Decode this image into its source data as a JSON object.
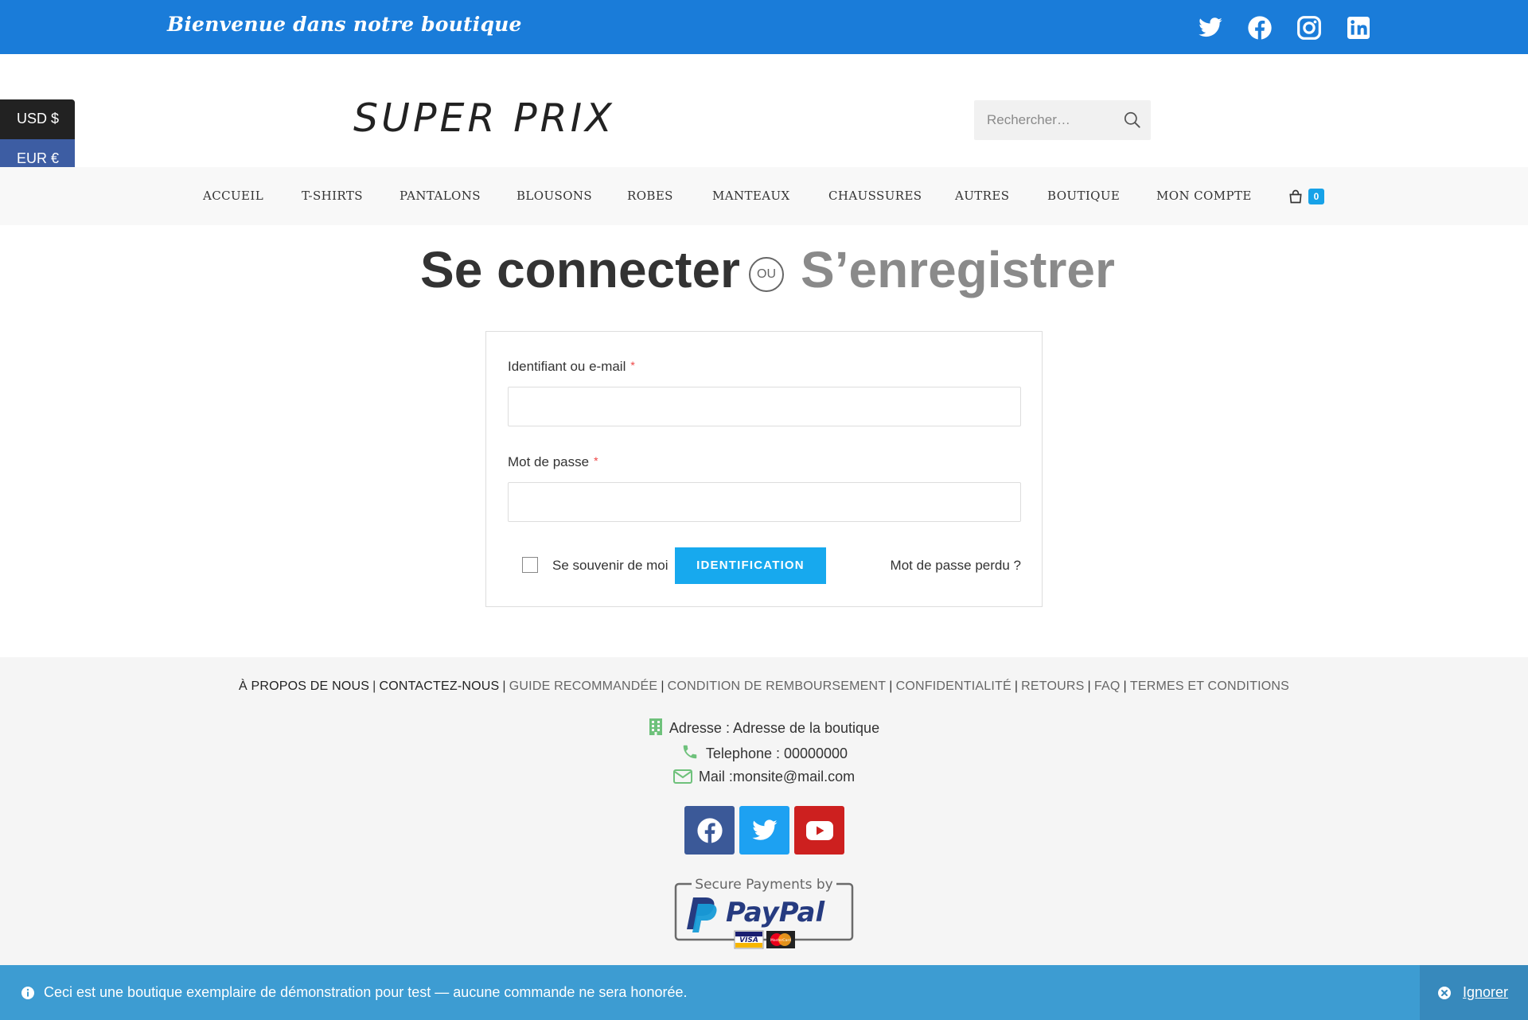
{
  "topbar": {
    "welcome": "Bienvenue dans notre boutique",
    "social_icons": [
      "twitter-icon",
      "facebook-icon",
      "instagram-icon",
      "linkedin-icon"
    ],
    "background": "#1a7cd9"
  },
  "currency": {
    "options": [
      "USD $",
      "EUR €"
    ],
    "selected": "USD $"
  },
  "header": {
    "logo": "SUPER PRIX",
    "search_placeholder": "Rechercher…"
  },
  "nav": {
    "items": [
      "ACCUEIL",
      "T-SHIRTS",
      "PANTALONS",
      "BLOUSONS",
      "ROBES",
      "MANTEAUX",
      "CHAUSSURES",
      "AUTRES",
      "BOUTIQUE",
      "MON COMPTE"
    ],
    "cart_count": "0"
  },
  "page": {
    "login_title": "Se connecter",
    "or_label": "OU",
    "register_title": "S’enregistrer"
  },
  "login_form": {
    "username_label": "Identifiant ou e-mail",
    "password_label": "Mot de passe",
    "required_mark": "*",
    "remember_label": "Se souvenir de moi",
    "submit_label": "IDENTIFICATION",
    "lost_password": "Mot de passe perdu ?"
  },
  "footer": {
    "links": [
      {
        "label": "À PROPOS DE NOUS",
        "dark": true
      },
      {
        "label": "CONTACTEZ-NOUS",
        "dark": true
      },
      {
        "label": "GUIDE RECOMMANDÉE",
        "dark": false
      },
      {
        "label": "CONDITION DE REMBOURSEMENT",
        "dark": false
      },
      {
        "label": "CONFIDENTIALITÉ",
        "dark": false
      },
      {
        "label": "RETOURS",
        "dark": false
      },
      {
        "label": "FAQ",
        "dark": false
      },
      {
        "label": "TERMES ET CONDITIONS",
        "dark": false
      }
    ],
    "address": "Adresse : Adresse de la boutique",
    "phone": "Telephone : 00000000",
    "mail": "Mail :monsite@mail.com",
    "social_buttons": [
      "facebook-icon",
      "twitter-icon",
      "youtube-icon"
    ],
    "paypal": {
      "caption": "Secure Payments by",
      "brand": "PayPal",
      "cards": [
        "VISA",
        "MasterCard"
      ]
    }
  },
  "notice": {
    "message": "Ceci est une boutique exemplaire de démonstration pour test — aucune commande ne sera honorée.",
    "dismiss": "Ignorer"
  },
  "colors": {
    "accent": "#17a9ee",
    "notice": "#3d9cd2",
    "facebook": "#3b5998",
    "twitter": "#1da1f2",
    "youtube": "#cd201f",
    "contact_icon": "#6ec17b"
  }
}
